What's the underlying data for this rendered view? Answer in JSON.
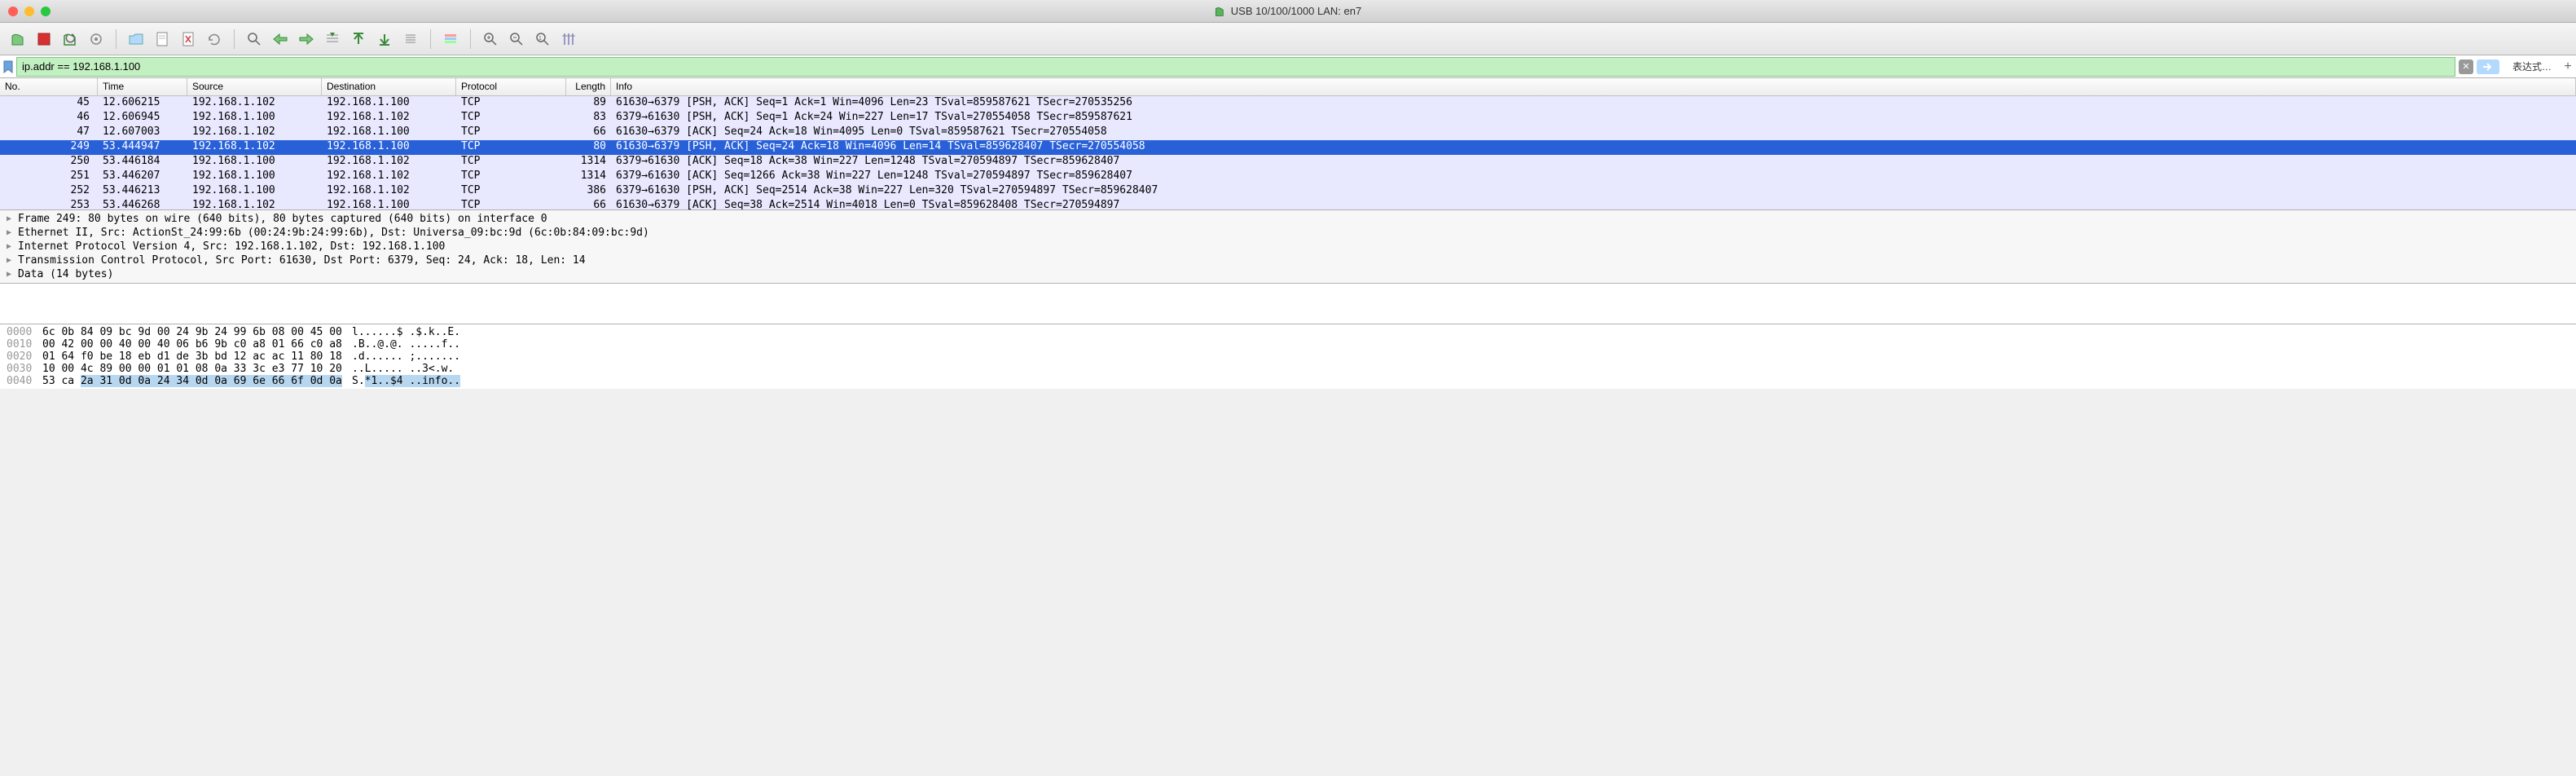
{
  "window": {
    "title": "USB 10/100/1000 LAN: en7"
  },
  "filter": {
    "value": "ip.addr == 192.168.1.100",
    "expression_label": "表达式…",
    "clear": "✕"
  },
  "columns": {
    "no": "No.",
    "time": "Time",
    "source": "Source",
    "destination": "Destination",
    "protocol": "Protocol",
    "length": "Length",
    "info": "Info"
  },
  "packets": [
    {
      "no": "45",
      "time": "12.606215",
      "src": "192.168.1.102",
      "dst": "192.168.1.100",
      "proto": "TCP",
      "len": "89",
      "info": "61630→6379 [PSH, ACK] Seq=1 Ack=1 Win=4096 Len=23 TSval=859587621 TSecr=270535256"
    },
    {
      "no": "46",
      "time": "12.606945",
      "src": "192.168.1.100",
      "dst": "192.168.1.102",
      "proto": "TCP",
      "len": "83",
      "info": "6379→61630 [PSH, ACK] Seq=1 Ack=24 Win=227 Len=17 TSval=270554058 TSecr=859587621"
    },
    {
      "no": "47",
      "time": "12.607003",
      "src": "192.168.1.102",
      "dst": "192.168.1.100",
      "proto": "TCP",
      "len": "66",
      "info": "61630→6379 [ACK] Seq=24 Ack=18 Win=4095 Len=0 TSval=859587621 TSecr=270554058"
    },
    {
      "no": "249",
      "time": "53.444947",
      "src": "192.168.1.102",
      "dst": "192.168.1.100",
      "proto": "TCP",
      "len": "80",
      "info": "61630→6379 [PSH, ACK] Seq=24 Ack=18 Win=4096 Len=14 TSval=859628407 TSecr=270554058",
      "sel": true
    },
    {
      "no": "250",
      "time": "53.446184",
      "src": "192.168.1.100",
      "dst": "192.168.1.102",
      "proto": "TCP",
      "len": "1314",
      "info": "6379→61630 [ACK] Seq=18 Ack=38 Win=227 Len=1248 TSval=270594897 TSecr=859628407"
    },
    {
      "no": "251",
      "time": "53.446207",
      "src": "192.168.1.100",
      "dst": "192.168.1.102",
      "proto": "TCP",
      "len": "1314",
      "info": "6379→61630 [ACK] Seq=1266 Ack=38 Win=227 Len=1248 TSval=270594897 TSecr=859628407"
    },
    {
      "no": "252",
      "time": "53.446213",
      "src": "192.168.1.100",
      "dst": "192.168.1.102",
      "proto": "TCP",
      "len": "386",
      "info": "6379→61630 [PSH, ACK] Seq=2514 Ack=38 Win=227 Len=320 TSval=270594897 TSecr=859628407"
    },
    {
      "no": "253",
      "time": "53.446268",
      "src": "192.168.1.102",
      "dst": "192.168.1.100",
      "proto": "TCP",
      "len": "66",
      "info": "61630→6379 [ACK] Seq=38 Ack=2514 Win=4018 Len=0 TSval=859628408 TSecr=270594897"
    }
  ],
  "details": [
    "Frame 249: 80 bytes on wire (640 bits), 80 bytes captured (640 bits) on interface 0",
    "Ethernet II, Src: ActionSt_24:99:6b (00:24:9b:24:99:6b), Dst: Universa_09:bc:9d (6c:0b:84:09:bc:9d)",
    "Internet Protocol Version 4, Src: 192.168.1.102, Dst: 192.168.1.100",
    "Transmission Control Protocol, Src Port: 61630, Dst Port: 6379, Seq: 24, Ack: 18, Len: 14",
    "Data (14 bytes)"
  ],
  "hex": [
    {
      "off": "0000",
      "b": "6c 0b 84 09 bc 9d 00 24  9b 24 99 6b 08 00 45 00",
      "a": "l......$ .$.k..E."
    },
    {
      "off": "0010",
      "b": "00 42 00 00 40 00 40 06  b6 9b c0 a8 01 66 c0 a8",
      "a": ".B..@.@. .....f.."
    },
    {
      "off": "0020",
      "b": "01 64 f0 be 18 eb d1 de  3b bd 12 ac ac 11 80 18",
      "a": ".d...... ;......."
    },
    {
      "off": "0030",
      "b": "10 00 4c 89 00 00 01 01  08 0a 33 3c e3 77 10 20",
      "a": "..L..... ..3<.w. "
    },
    {
      "off": "0040",
      "b": "53 ca ",
      "bhl": "2a 31 0d 0a 24 34  0d 0a 69 6e 66 6f 0d 0a",
      "a": "S.",
      "ahl": "*1..$4 ..info.."
    }
  ]
}
